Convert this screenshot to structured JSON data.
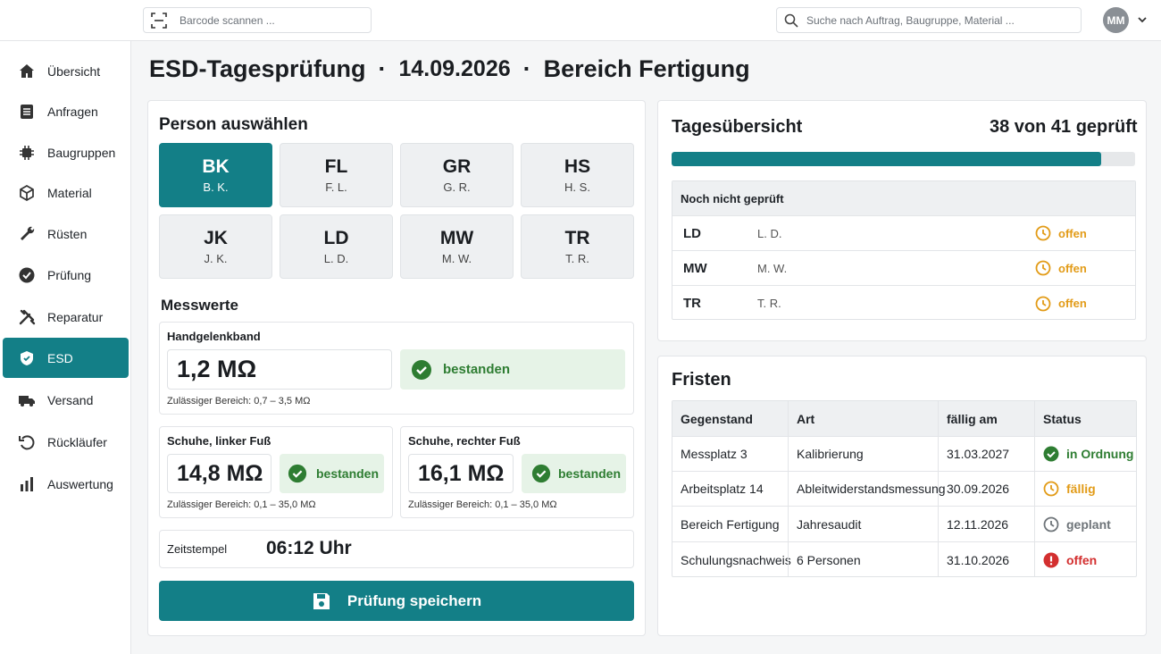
{
  "topbar": {
    "barcode_placeholder": "Barcode scannen ...",
    "search_placeholder": "Suche nach Auftrag, Baugruppe, Material ...",
    "user_initials": "MM"
  },
  "sidebar": {
    "items": [
      {
        "label": "Übersicht",
        "icon": "home-icon"
      },
      {
        "label": "Anfragen",
        "icon": "list-icon"
      },
      {
        "label": "Baugruppen",
        "icon": "chip-icon"
      },
      {
        "label": "Material",
        "icon": "box-icon"
      },
      {
        "label": "Rüsten",
        "icon": "wrench-icon"
      },
      {
        "label": "Prüfung",
        "icon": "check-circle-icon"
      },
      {
        "label": "Reparatur",
        "icon": "tools-icon"
      },
      {
        "label": "ESD",
        "icon": "shield-icon",
        "active": true
      },
      {
        "label": "Versand",
        "icon": "truck-icon"
      },
      {
        "label": "Rückläufer",
        "icon": "return-icon"
      },
      {
        "label": "Auswertung",
        "icon": "chart-icon"
      }
    ]
  },
  "page": {
    "title": "ESD-Tagesprüfung",
    "date": "14.09.2026",
    "area": "Bereich Fertigung",
    "separator": "·"
  },
  "person": {
    "heading": "Person auswählen",
    "people": [
      {
        "code": "BK",
        "name": "B. K.",
        "selected": true
      },
      {
        "code": "FL",
        "name": "F. L."
      },
      {
        "code": "GR",
        "name": "G. R."
      },
      {
        "code": "HS",
        "name": "H. S."
      },
      {
        "code": "JK",
        "name": "J. K."
      },
      {
        "code": "LD",
        "name": "L. D."
      },
      {
        "code": "MW",
        "name": "M. W."
      },
      {
        "code": "TR",
        "name": "T. R."
      }
    ]
  },
  "messwerte": {
    "heading": "Messwerte",
    "wrist": {
      "label": "Handgelenkband",
      "value": "1,2 MΩ",
      "status": "bestanden",
      "range": "Zulässiger Bereich: 0,7 – 3,5 MΩ"
    },
    "left": {
      "label": "Schuhe, linker Fuß",
      "value": "14,8 MΩ",
      "status": "bestanden",
      "range": "Zulässiger Bereich: 0,1 – 35,0 MΩ"
    },
    "right": {
      "label": "Schuhe, rechter Fuß",
      "value": "16,1 MΩ",
      "status": "bestanden",
      "range": "Zulässiger Bereich: 0,1 – 35,0 MΩ"
    },
    "timestamp_label": "Zeitstempel",
    "timestamp_value": "06:12 Uhr",
    "save_label": "Prüfung speichern"
  },
  "overview": {
    "heading": "Tagesübersicht",
    "summary": "38 von 41 geprüft",
    "progress": 0.927,
    "pending_heading": "Noch nicht geprüft",
    "pending": [
      {
        "code": "LD",
        "name": "L. D.",
        "status": "offen"
      },
      {
        "code": "MW",
        "name": "M. W.",
        "status": "offen"
      },
      {
        "code": "TR",
        "name": "T. R.",
        "status": "offen"
      }
    ]
  },
  "deadlines": {
    "heading": "Fristen",
    "columns": [
      "Gegenstand",
      "Art",
      "fällig am",
      "Status"
    ],
    "rows": [
      {
        "item": "Messplatz 3",
        "type": "Kalibrierung",
        "due": "31.03.2027",
        "status": "in Ordnung",
        "kind": "ok"
      },
      {
        "item": "Arbeitsplatz 14",
        "type": "Ableitwiderstandsmessung",
        "due": "30.09.2026",
        "status": "fällig",
        "kind": "due"
      },
      {
        "item": "Bereich Fertigung",
        "type": "Jahresaudit",
        "due": "12.11.2026",
        "status": "geplant",
        "kind": "planned"
      },
      {
        "item": "Schulungsnachweis",
        "type": "6 Personen",
        "due": "31.10.2026",
        "status": "offen",
        "kind": "open"
      }
    ]
  },
  "colors": {
    "accent": "#137f87",
    "success": "#2e7d32",
    "warning": "#e29b17",
    "danger": "#d32f2f"
  }
}
